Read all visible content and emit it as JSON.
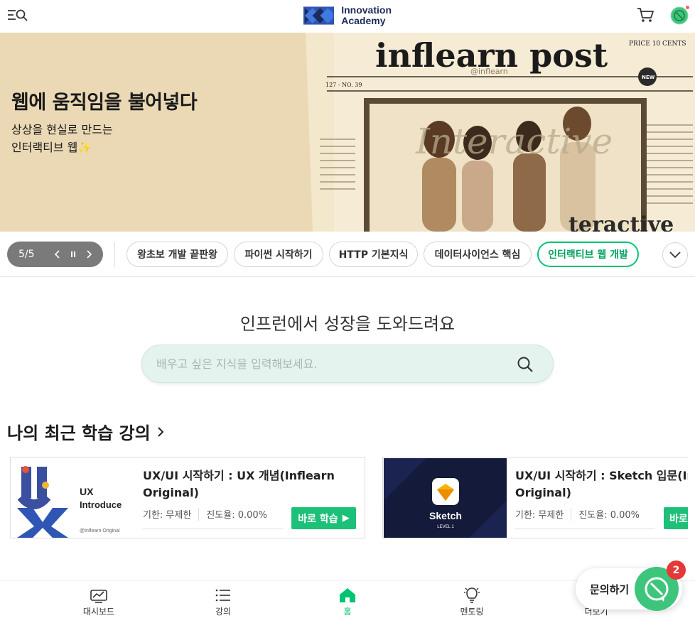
{
  "header": {
    "logo_line1": "Innovation",
    "logo_line2": "Academy",
    "menu_icon": "hamburger-search-icon",
    "cart_icon": "cart-icon",
    "profile_icon": "profile-icon",
    "notification_color": "#ff5a5a"
  },
  "banner": {
    "title": "웹에 움직임을 불어넣다",
    "subtitle_line1": "상상을 현실로 만드는",
    "subtitle_line2": "인터랙티브 웹",
    "sparkle": "✨",
    "art_masthead": "inflearn post",
    "art_price": "PRICE 10 CENTS",
    "art_issue": "127 - NO. 39",
    "art_brand": "@inflearn",
    "art_headline": "Interactive",
    "art_headline_bottom": "teractive",
    "art_badge": "NEW"
  },
  "carousel": {
    "counter": "5/5",
    "prev_icon": "chevron-left-icon",
    "pause_icon": "pause-icon",
    "next_icon": "chevron-right-icon",
    "tabs": [
      {
        "label": "왕초보 개발 끝판왕"
      },
      {
        "label": "파이썬 시작하기"
      },
      {
        "label": "HTTP 기본지식"
      },
      {
        "label": "데이터사이언스 핵심"
      },
      {
        "label": "인터랙티브 웹 개발"
      }
    ],
    "active_index": 4,
    "accent_color": "#00c471"
  },
  "search": {
    "heading": "인프런에서 성장을 도와드려요",
    "placeholder": "배우고 싶은 지식을 입력해보세요."
  },
  "recent": {
    "title": "나의 최근 학습 강의",
    "courses": [
      {
        "title_line1": "UX/UI 시작하기 : UX 개념(Inflearn",
        "title_line2": "Original)",
        "thumb_text1": "UX",
        "thumb_text2": "Introduce",
        "thumb_brand": "@Inflearn Original",
        "deadline": "기한: 무제한",
        "progress": "진도율: 0.00%",
        "button": "바로 학습"
      },
      {
        "title_line1": "UX/UI 시작하기 : Sketch 입문(Infl",
        "title_line2": "Original)",
        "thumb_text1": "Sketch",
        "thumb_text2": "LEVEL 1",
        "deadline": "기한: 무제한",
        "progress": "진도율: 0.00%",
        "button": "바로"
      }
    ]
  },
  "bottom_nav": {
    "items": [
      {
        "label": "대시보드",
        "icon": "dashboard-icon"
      },
      {
        "label": "강의",
        "icon": "list-icon"
      },
      {
        "label": "홈",
        "icon": "home-icon"
      },
      {
        "label": "멘토링",
        "icon": "lightbulb-icon"
      },
      {
        "label": "더보기",
        "icon": "more-icon"
      }
    ],
    "active_index": 2
  },
  "inquiry": {
    "label": "문의하기",
    "badge": "2"
  }
}
